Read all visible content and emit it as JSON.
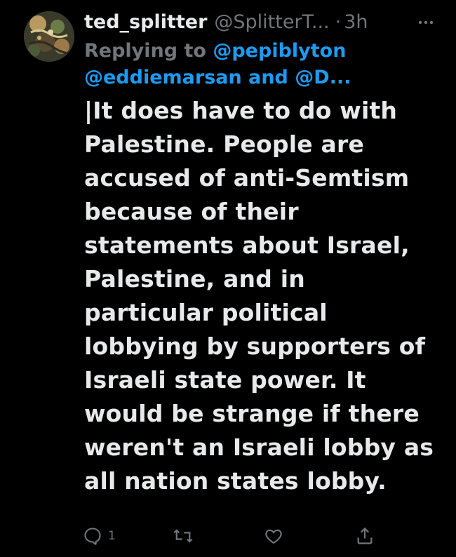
{
  "tweet": {
    "display_name": "ted_splitter",
    "handle": "@SplitterT...",
    "separator": "·",
    "time": "3h",
    "replying_prefix": "Replying to ",
    "replying_mention_1": "@pepiblyton",
    "replying_mention_2": "@eddiemarsan",
    "replying_and": " and ",
    "replying_mention_3": "@D...",
    "text": "|It does have to do with\nPalestine. People are\naccused of anti-Semtism\nbecause of their\nstatements about Israel,\nPalestine, and in\nparticular political\nlobbying by supporters of\nIsraeli state power. It\nwould be strange if there\nweren't an Israeli lobby as\nall nation states lobby."
  },
  "actions": {
    "reply_count": "1",
    "reply_icon": "reply-icon",
    "retweet_icon": "retweet-icon",
    "like_icon": "heart-icon",
    "share_icon": "share-icon",
    "more_icon": "more-icon"
  },
  "colors": {
    "background": "#000000",
    "text": "#e7e9ea",
    "muted": "#71767b",
    "link": "#1d9bf0"
  }
}
